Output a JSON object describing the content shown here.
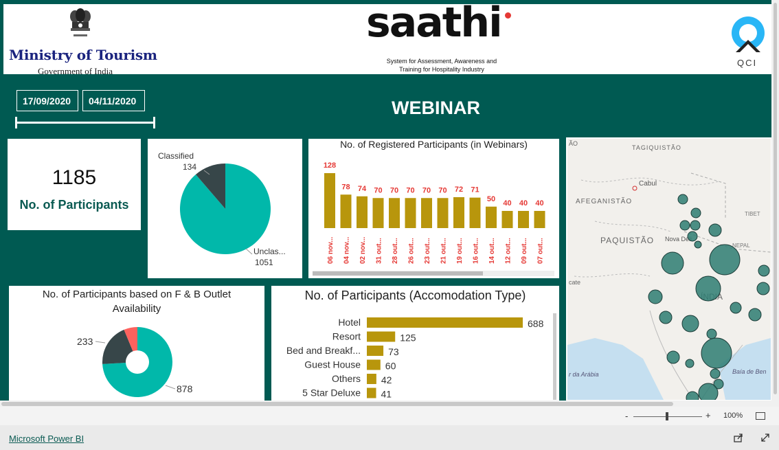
{
  "header": {
    "ministry_title": "Ministry of Tourism",
    "ministry_sub": "Government of India",
    "saathi_word": "saathi",
    "saathi_tagline_1": "System for Assessment, Awareness and",
    "saathi_tagline_2": "Training for Hospitality Industry",
    "qci_text": "QCI"
  },
  "filters": {
    "start_date": "17/09/2020",
    "end_date": "04/11/2020"
  },
  "page_title": "WEBINAR",
  "kpi": {
    "value": "1185",
    "label": "No. of Participants"
  },
  "classification_pie": {
    "title": "",
    "slices": [
      {
        "label": "Classified",
        "value": 134,
        "value_text": "134",
        "color": "#374649"
      },
      {
        "label": "Unclas...",
        "value": 1051,
        "value_text": "1051",
        "color": "#01b8aa"
      }
    ]
  },
  "registered_chart": {
    "title": "No. of Registered Participants (in Webinars)",
    "bar_color": "#b8960c",
    "label_color": "#e53935"
  },
  "fb_donut": {
    "title_1": "No. of Participants based on F & B Outlet",
    "title_2": "Availability",
    "slices": [
      {
        "value": 878,
        "value_text": "878",
        "color": "#01b8aa"
      },
      {
        "value": 233,
        "value_text": "233",
        "color": "#374649"
      },
      {
        "value": 74,
        "color": "#fd625e"
      }
    ]
  },
  "accommodation_chart": {
    "title": "No. of Participants (Accomodation Type)",
    "bar_color": "#b8960c"
  },
  "map": {
    "labels": {
      "tajikistan": "TAGIQUISTÃO",
      "kabul": "Cabul",
      "afghanistan": "AFEGANISTÃO",
      "tibet": "TIBET",
      "pakistan": "PAQUISTÃO",
      "delhi": "Nova Déli",
      "nepal": "NEPAL",
      "india": "ÍNDIA",
      "arabian_sea": "r da Arábia",
      "bay_of_bengal": "Baía de Ben",
      "cate": "cate",
      "ao": "ÃO"
    },
    "bubble_color": "#2e7d72"
  },
  "zoom": {
    "minus": "-",
    "plus": "+",
    "percent": "100%"
  },
  "footer": {
    "link": "Microsoft Power BI"
  },
  "chart_data": [
    {
      "type": "bar",
      "title": "No. of Registered Participants (in Webinars)",
      "categories": [
        "06 nov...",
        "04 nov...",
        "02 nov...",
        "31 out...",
        "28 out...",
        "26 out...",
        "23 out...",
        "21 out...",
        "19 out...",
        "16 out...",
        "14 out...",
        "12 out...",
        "09 out...",
        "07 out..."
      ],
      "values": [
        128,
        78,
        74,
        70,
        70,
        70,
        70,
        70,
        72,
        71,
        50,
        40,
        40,
        40
      ],
      "ylim": [
        0,
        140
      ]
    },
    {
      "type": "bar",
      "orientation": "horizontal",
      "title": "No. of Participants (Accomodation Type)",
      "categories": [
        "Hotel",
        "Resort",
        "Bed and Breakf...",
        "Guest House",
        "Others",
        "5 Star Deluxe"
      ],
      "values": [
        688,
        125,
        73,
        60,
        42,
        41
      ],
      "xlim": [
        0,
        700
      ]
    },
    {
      "type": "pie",
      "categories": [
        "Classified",
        "Unclas..."
      ],
      "values": [
        134,
        1051
      ]
    },
    {
      "type": "pie",
      "title": "No. of Participants based on F & B Outlet Availability",
      "values": [
        878,
        233,
        74
      ]
    }
  ]
}
